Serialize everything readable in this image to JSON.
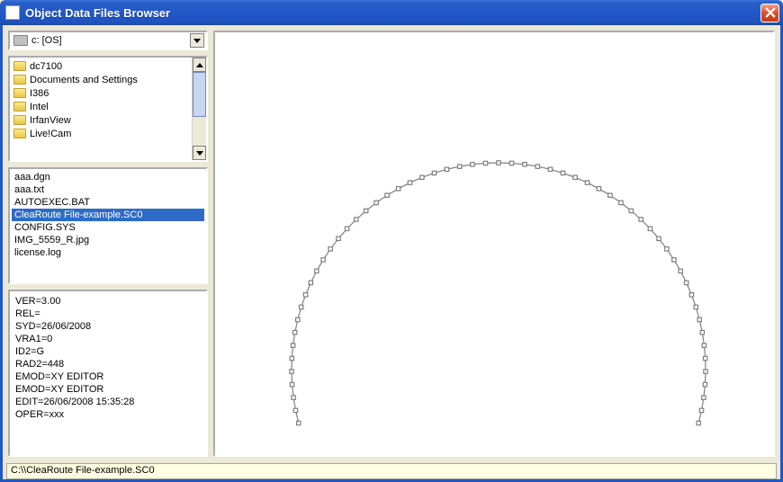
{
  "window": {
    "title": "Object Data Files Browser"
  },
  "drive": {
    "selected": "c: [OS]"
  },
  "folders": {
    "items": [
      {
        "name": "dc7100"
      },
      {
        "name": "Documents and Settings"
      },
      {
        "name": "I386"
      },
      {
        "name": "Intel"
      },
      {
        "name": "IrfanView"
      },
      {
        "name": "Live!Cam"
      }
    ]
  },
  "files": {
    "items": [
      {
        "name": "aaa.dgn",
        "selected": false
      },
      {
        "name": "aaa.txt",
        "selected": false
      },
      {
        "name": "AUTOEXEC.BAT",
        "selected": false
      },
      {
        "name": "CleaRoute File-example.SC0",
        "selected": true
      },
      {
        "name": "CONFIG.SYS",
        "selected": false
      },
      {
        "name": "IMG_5559_R.jpg",
        "selected": false
      },
      {
        "name": "license.log",
        "selected": false
      }
    ]
  },
  "metadata": {
    "lines": [
      "VER=3.00",
      "REL=",
      "SYD=26/06/2008",
      "VRA1=0",
      "ID2=G",
      "RAD2=448",
      "EMOD=XY EDITOR",
      "EMOD=XY EDITOR",
      "EDIT=26/06/2008 15:35:28",
      "OPER=xxx"
    ]
  },
  "status": {
    "path": "C:\\\\CleaRoute File-example.SC0"
  }
}
